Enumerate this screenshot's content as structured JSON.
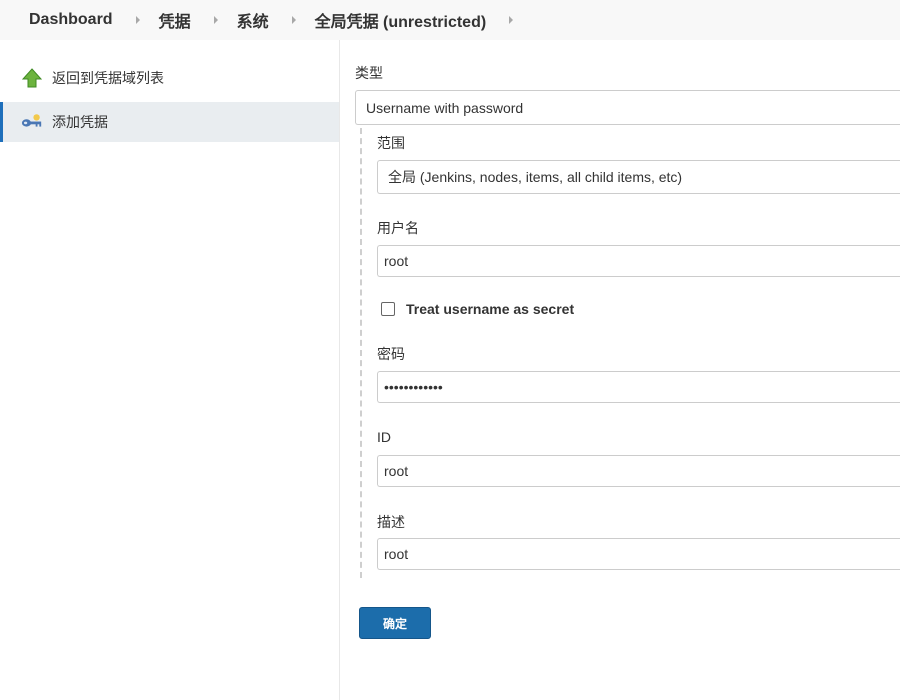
{
  "breadcrumb": {
    "items": [
      "Dashboard",
      "凭据",
      "系统",
      "全局凭据 (unrestricted)"
    ]
  },
  "sidebar": {
    "items": [
      {
        "label": "返回到凭据域列表",
        "icon": "up-arrow-icon"
      },
      {
        "label": "添加凭据",
        "icon": "key-icon"
      }
    ]
  },
  "form": {
    "kind_label": "类型",
    "kind_value": "Username with password",
    "scope_label": "范围",
    "scope_value": "全局 (Jenkins, nodes, items, all child items, etc)",
    "username_label": "用户名",
    "username_value": "root",
    "secret_checkbox_label": "Treat username as secret",
    "password_label": "密码",
    "password_value": "••••••••••••",
    "id_label": "ID",
    "id_value": "root",
    "description_label": "描述",
    "description_value": "root",
    "submit_label": "确定"
  },
  "colors": {
    "accent": "#1e6fbb",
    "button": "#1c6dab",
    "sidebar_active_bg": "#e9edf0"
  }
}
